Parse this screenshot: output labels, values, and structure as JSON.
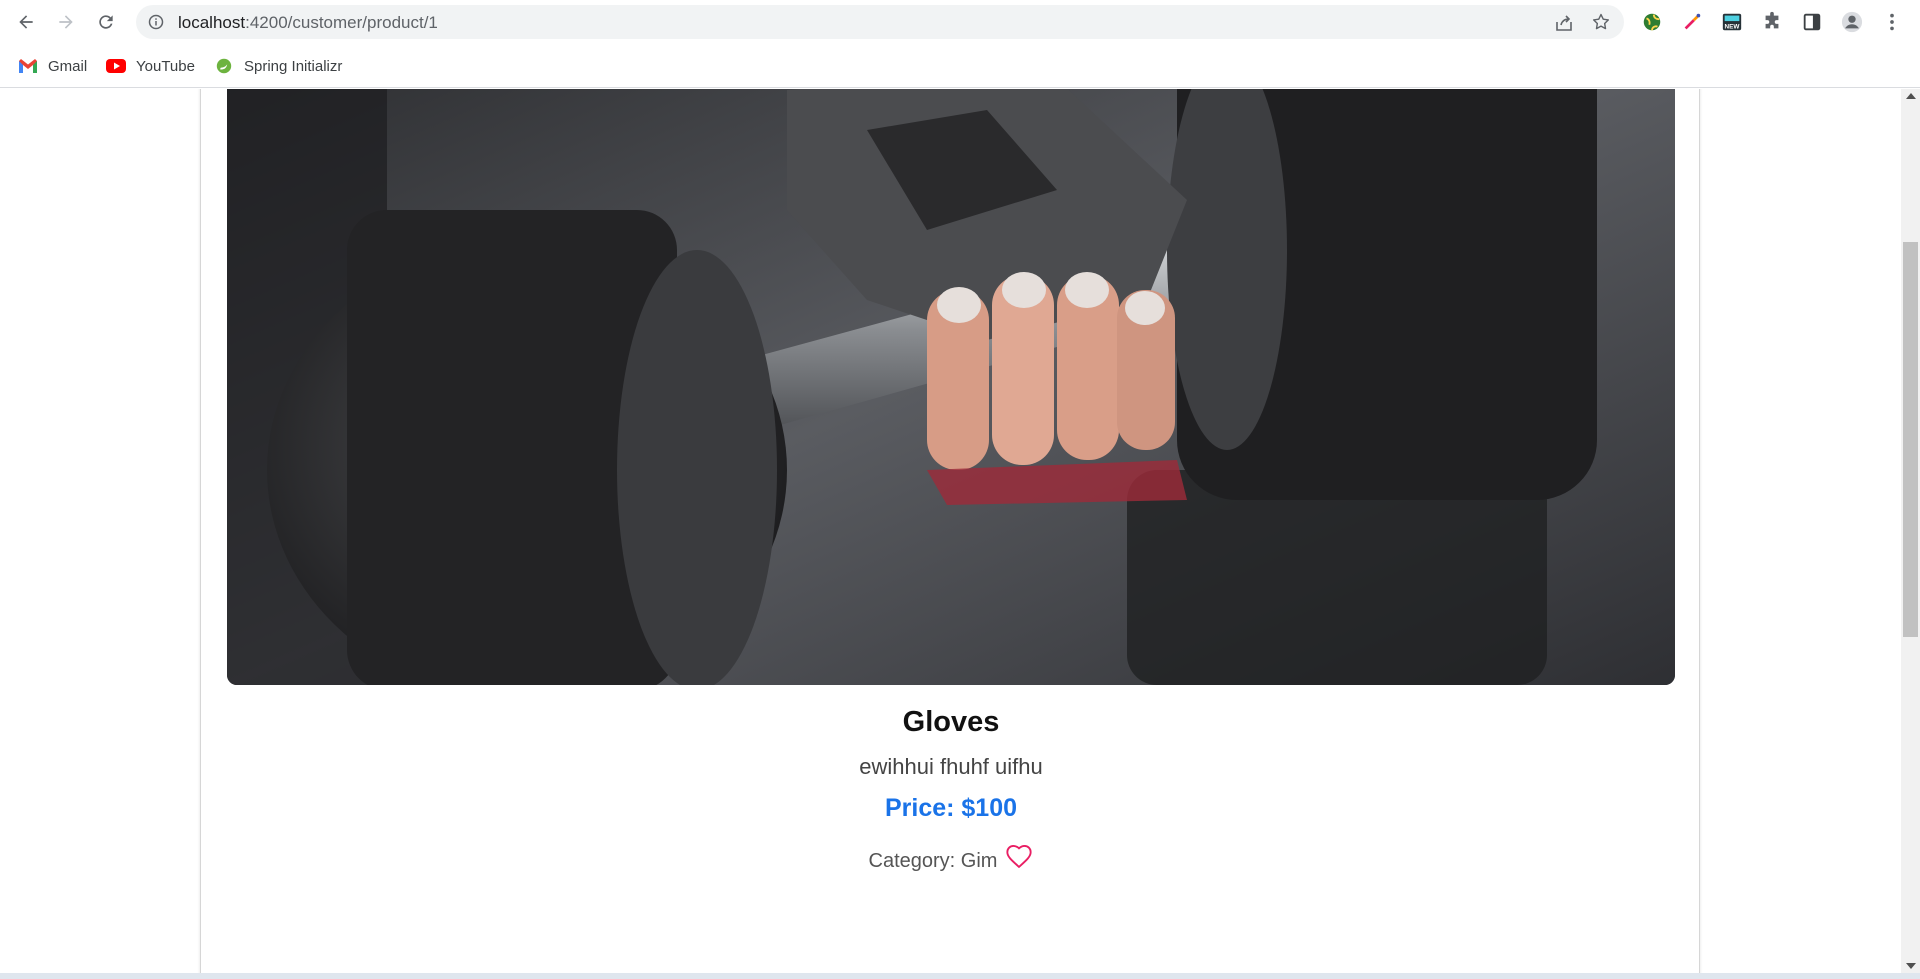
{
  "browser": {
    "url_host": "localhost",
    "url_path": ":4200/customer/product/1",
    "bookmarks": [
      {
        "label": "Gmail",
        "icon": "gmail-icon"
      },
      {
        "label": "YouTube",
        "icon": "youtube-icon"
      },
      {
        "label": "Spring Initializr",
        "icon": "spring-icon"
      }
    ],
    "extension_badge": "NEW"
  },
  "product": {
    "name": "Gloves",
    "description": "ewihhui fhuhf uifhu",
    "price": "Price: $100",
    "category": "Category: Gim",
    "image_icon": "dumbbell-gloves-photo",
    "favorite_icon": "heart-icon"
  },
  "colors": {
    "price": "#1a73e8",
    "heart": "#e91e63"
  }
}
